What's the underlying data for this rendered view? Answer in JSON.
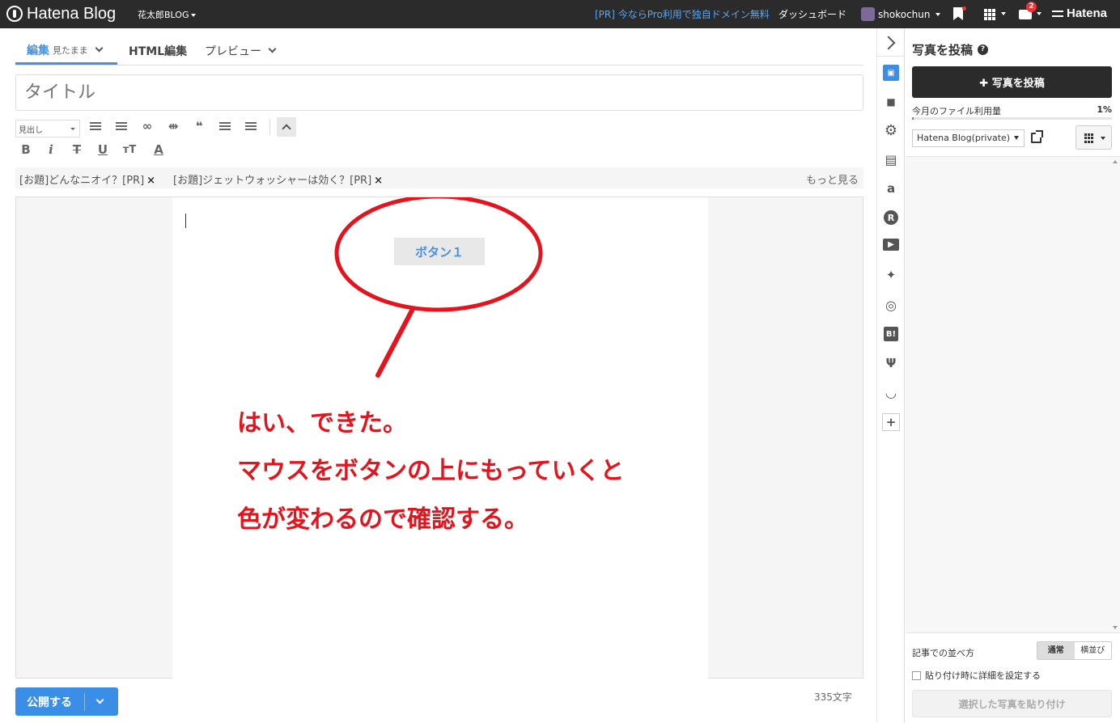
{
  "topbar": {
    "logo_text": "Hatena Blog",
    "blog_name": "花太郎BLOG",
    "pr_link": "[PR] 今ならPro利用で独自ドメイン無料",
    "dashboard": "ダッシュボード",
    "username": "shokochun",
    "notification_count": "2",
    "hatena": "Hatena"
  },
  "tabs": [
    {
      "label": "編集",
      "sub": "見たまま"
    },
    {
      "label": "HTML編集"
    },
    {
      "label": "プレビュー"
    }
  ],
  "title_placeholder": "タイトル",
  "toolbar": {
    "heading_select": "見出し",
    "bold": "B",
    "italic": "i",
    "underline": "U",
    "fontsize": "тT",
    "color": "A"
  },
  "topics": [
    "[お題]どんなニオイ？[PR]",
    "[お題]ジェットウォッシャーは効く？[PR]"
  ],
  "topic_close": "×",
  "topics_more": "もっと見る",
  "editor": {
    "button_label": "ボタン１",
    "annotation_lines": [
      "はい、できた。",
      "マウスをボタンの上にもっていくと",
      "色が変わるので確認する。"
    ],
    "annotation_color": "#e3141e"
  },
  "footer": {
    "publish": "公開する",
    "char_count": "335文字"
  },
  "sidebar": {
    "title": "写真を投稿",
    "help": "?",
    "upload_button": "✚ 写真を投稿",
    "usage_label": "今月のファイル利用量",
    "usage_percent": "1%",
    "usage_value": 1,
    "album_select": "Hatena Blog(private)",
    "sort_label": "記事での並べ方",
    "sort_options": [
      "通常",
      "横並び"
    ],
    "checkbox_label": "貼り付け時に詳細を設定する",
    "paste_button": "選択した写真を貼り付け"
  },
  "icon_strip": [
    "photo-icon",
    "folder-icon",
    "gear-icon",
    "document-icon",
    "amazon-icon",
    "rakuten-icon",
    "youtube-icon",
    "twitter-icon",
    "instagram-icon",
    "hatena-bookmark-icon",
    "restaurant-icon",
    "smile-icon",
    "plus-icon"
  ],
  "colors": {
    "topbar_bg": "#2b2b2b",
    "accent": "#3a8ee6",
    "annotation": "#e3141e"
  }
}
